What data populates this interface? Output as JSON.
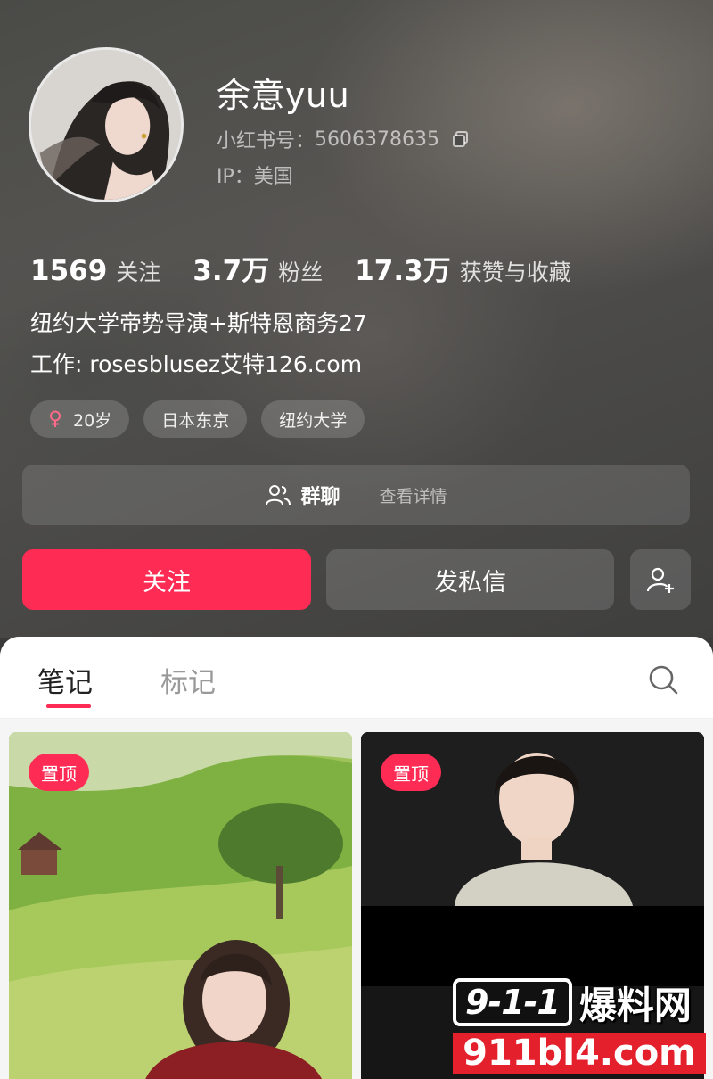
{
  "profile": {
    "nickname": "余意yuu",
    "redid_label": "小红书号：",
    "redid": "5606378635",
    "ip": "IP：美国",
    "stats": [
      {
        "num": "1569",
        "label": "关注"
      },
      {
        "num": "3.7万",
        "label": "粉丝"
      },
      {
        "num": "17.3万",
        "label": "获赞与收藏"
      }
    ],
    "bio_line1": "纽约大学帝势导演+斯特恩商务27",
    "bio_line2": "工作: rosesblusez艾特126.com",
    "tags": [
      "20岁",
      "日本东京",
      "纽约大学"
    ]
  },
  "group": {
    "label": "群聊",
    "detail": "查看详情"
  },
  "actions": {
    "follow": "关注",
    "message": "发私信"
  },
  "tabs": [
    {
      "label": "笔记",
      "active": true
    },
    {
      "label": "标记",
      "active": false
    }
  ],
  "cards": [
    {
      "badge": "置顶"
    },
    {
      "badge": "置顶"
    }
  ],
  "watermark": {
    "box": "9-1-1",
    "cn": "爆料网",
    "domain": "911bl4.com"
  },
  "colors": {
    "accent": "#fe2c55",
    "watermark_red": "#e3202b"
  },
  "icons": [
    "copy-icon",
    "female-icon",
    "group-icon",
    "add-user-icon",
    "search-icon"
  ]
}
